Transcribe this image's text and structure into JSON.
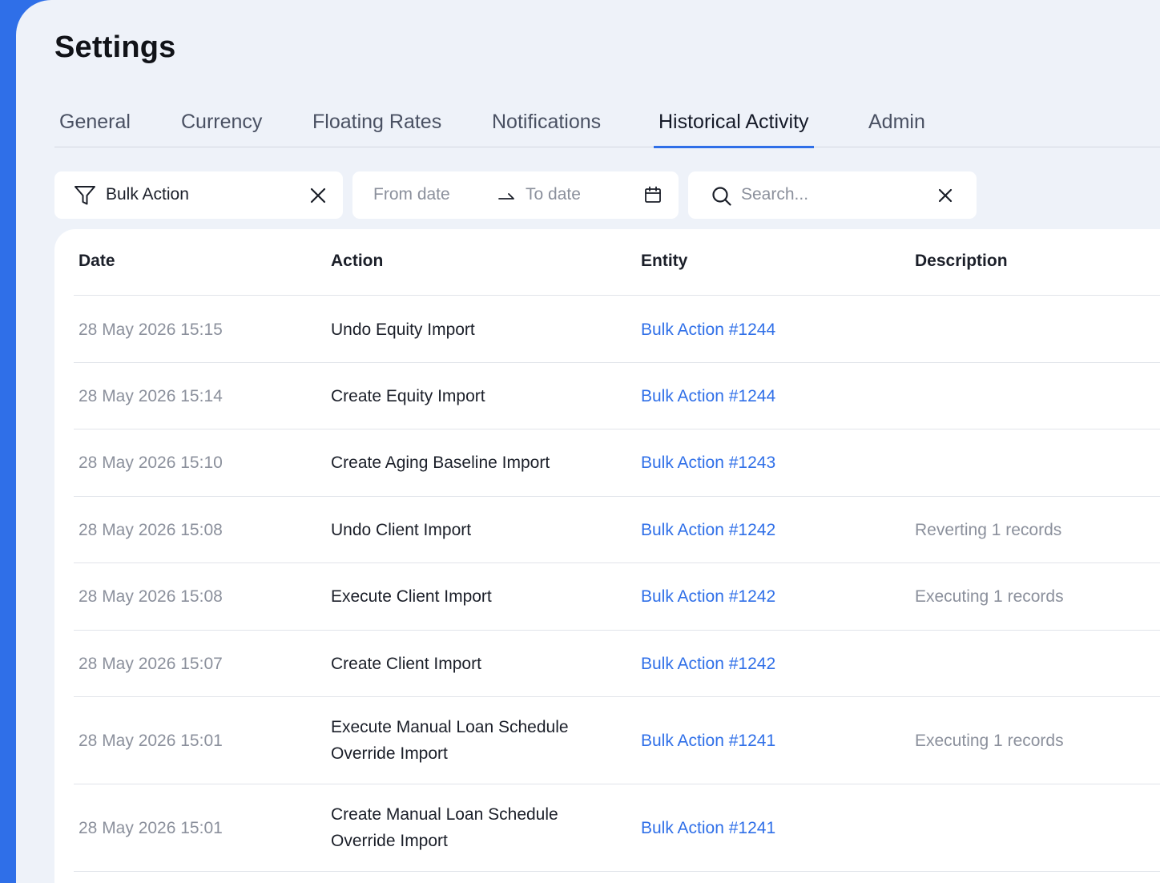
{
  "page": {
    "title": "Settings"
  },
  "tabs": [
    {
      "label": "General"
    },
    {
      "label": "Currency"
    },
    {
      "label": "Floating Rates"
    },
    {
      "label": "Notifications"
    },
    {
      "label": "Historical Activity",
      "active": true
    },
    {
      "label": "Admin"
    }
  ],
  "filters": {
    "type_value": "Bulk Action",
    "from_placeholder": "From date",
    "to_placeholder": "To date",
    "search_placeholder": "Search..."
  },
  "table": {
    "columns": [
      "Date",
      "Action",
      "Entity",
      "Description"
    ],
    "rows": [
      {
        "date": "28 May 2026 15:15",
        "action": "Undo Equity Import",
        "entity": "Bulk Action #1244",
        "description": ""
      },
      {
        "date": "28 May 2026 15:14",
        "action": "Create Equity Import",
        "entity": "Bulk Action #1244",
        "description": ""
      },
      {
        "date": "28 May 2026 15:10",
        "action": "Create Aging Baseline Import",
        "entity": "Bulk Action #1243",
        "description": ""
      },
      {
        "date": "28 May 2026 15:08",
        "action": "Undo Client Import",
        "entity": "Bulk Action #1242",
        "description": "Reverting 1 records"
      },
      {
        "date": "28 May 2026 15:08",
        "action": "Execute Client Import",
        "entity": "Bulk Action #1242",
        "description": "Executing 1 records"
      },
      {
        "date": "28 May 2026 15:07",
        "action": "Create Client Import",
        "entity": "Bulk Action #1242",
        "description": ""
      },
      {
        "date": "28 May 2026 15:01",
        "action": "Execute Manual Loan Schedule Override Import",
        "entity": "Bulk Action #1241",
        "description": "Executing 1 records"
      },
      {
        "date": "28 May 2026 15:01",
        "action": "Create Manual Loan Schedule Override Import",
        "entity": "Bulk Action #1241",
        "description": ""
      }
    ]
  },
  "colors": {
    "accent": "#2f6fe8",
    "background": "#eef2f9",
    "muted_text": "#8b909c"
  },
  "icons": [
    "filter-icon",
    "close-icon",
    "arrow-right-icon",
    "calendar-icon",
    "search-icon"
  ]
}
